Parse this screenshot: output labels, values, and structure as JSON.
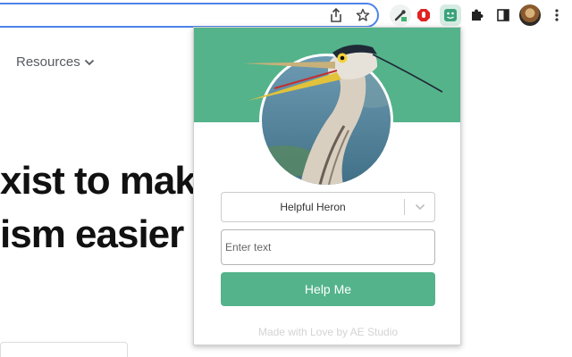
{
  "browser": {
    "toolbar_icons": [
      "share-icon",
      "bookmark-star-icon",
      "eyedropper-extension-icon",
      "adblock-extension-icon",
      "heron-extension-icon",
      "extensions-puzzle-icon",
      "side-panel-icon",
      "profile-avatar",
      "browser-menu-icon"
    ],
    "accent_color": "#4d84e8"
  },
  "page": {
    "nav_resources": "Resources",
    "hero_line_1": "xist to mak",
    "hero_line_2": "ism easier"
  },
  "popup": {
    "persona_selected": "Helpful Heron",
    "input_placeholder": "Enter text",
    "submit_label": "Help Me",
    "footer": "Made with Love by AE Studio",
    "brand_color": "#54b38b"
  }
}
